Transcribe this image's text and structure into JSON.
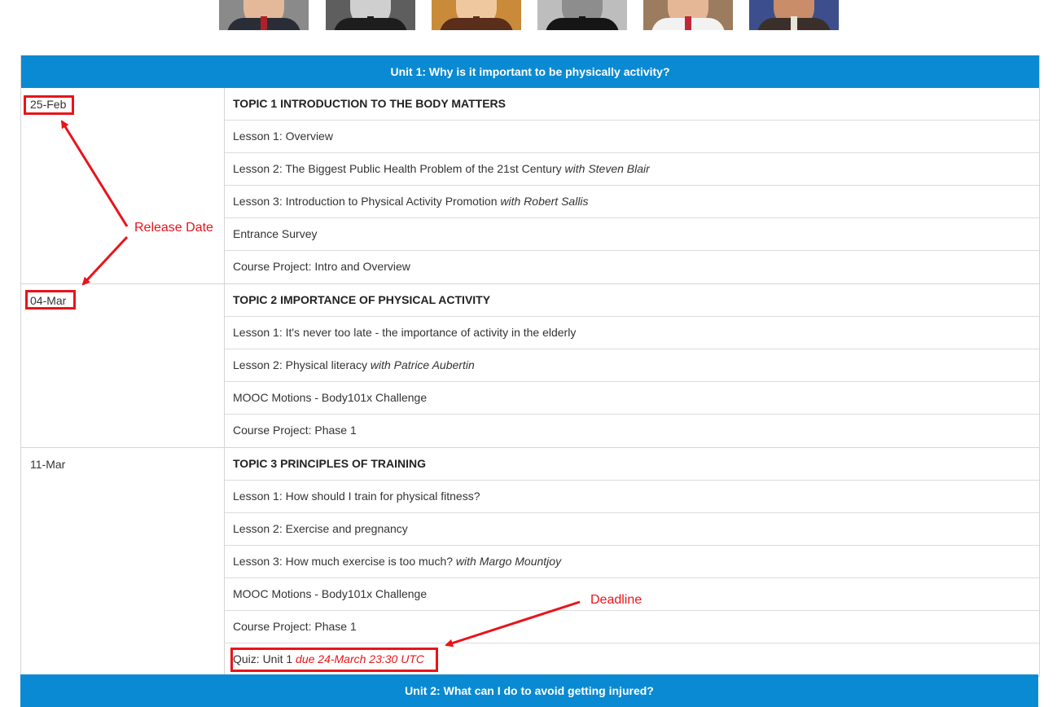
{
  "portraits": [
    {
      "name": "portrait-1",
      "bg": "#8a8a8a",
      "face": "#e3b99a",
      "suit": "#2a2d36",
      "tie": "#b0202a"
    },
    {
      "name": "portrait-2",
      "bg": "#5e5e5e",
      "face": "#cfcfcf",
      "suit": "#1d1d1d",
      "tie": "#1d1d1d"
    },
    {
      "name": "portrait-3",
      "bg": "#c98a3a",
      "face": "#f0c8a0",
      "suit": "#5a2e1a",
      "tie": "#5a2e1a"
    },
    {
      "name": "portrait-4",
      "bg": "#bdbdbd",
      "face": "#8d8d8d",
      "suit": "#151515",
      "tie": "#151515"
    },
    {
      "name": "portrait-5",
      "bg": "#9c7c5e",
      "face": "#e6b797",
      "suit": "#f2f2f2",
      "tie": "#c0283a"
    },
    {
      "name": "portrait-6",
      "bg": "#3c4f8c",
      "face": "#c98d6a",
      "suit": "#3a2f2a",
      "tie": "#e8e3d6"
    }
  ],
  "unit1": {
    "header": "Unit 1: Why is it important to be physically activity?",
    "topics": [
      {
        "date": "25-Feb",
        "title": "TOPIC 1 INTRODUCTION TO THE BODY MATTERS",
        "items": [
          {
            "text": "Lesson 1: Overview",
            "em": ""
          },
          {
            "text": "Lesson 2: The Biggest Public Health Problem of the 21st Century",
            "em": "with Steven Blair"
          },
          {
            "text": "Lesson 3: Introduction to Physical Activity Promotion",
            "em": "with Robert Sallis"
          },
          {
            "text": "Entrance Survey",
            "em": ""
          },
          {
            "text": "Course Project: Intro and Overview",
            "em": ""
          }
        ]
      },
      {
        "date": "04-Mar",
        "title": "TOPIC 2 IMPORTANCE OF PHYSICAL ACTIVITY",
        "items": [
          {
            "text": "Lesson 1: It's never too late - the importance of activity in the elderly",
            "em": ""
          },
          {
            "text": "Lesson 2: Physical literacy",
            "em": "with Patrice Aubertin"
          },
          {
            "text": "MOOC Motions - Body101x Challenge",
            "em": ""
          },
          {
            "text": "Course Project: Phase 1",
            "em": ""
          }
        ]
      },
      {
        "date": "11-Mar",
        "title": "TOPIC 3 PRINCIPLES OF TRAINING",
        "items": [
          {
            "text": "Lesson 1: How should I train for physical fitness?",
            "em": ""
          },
          {
            "text": "Lesson 2: Exercise and pregnancy",
            "em": ""
          },
          {
            "text": "Lesson 3: How much exercise is too much?",
            "em": "with Margo Mountjoy"
          },
          {
            "text": "MOOC Motions - Body101x Challenge",
            "em": ""
          },
          {
            "text": "Course Project: Phase 1",
            "em": ""
          },
          {
            "text": "Quiz: Unit 1",
            "em": "due 24-March 23:30 UTC",
            "due": true
          }
        ]
      }
    ]
  },
  "unit2": {
    "header": "Unit 2: What can I do to avoid getting injured?"
  },
  "annotations": {
    "release_date": "Release Date",
    "deadline": "Deadline"
  },
  "colors": {
    "unit_header_bg": "#0a8ad2",
    "annotation_red": "#e8141a"
  }
}
